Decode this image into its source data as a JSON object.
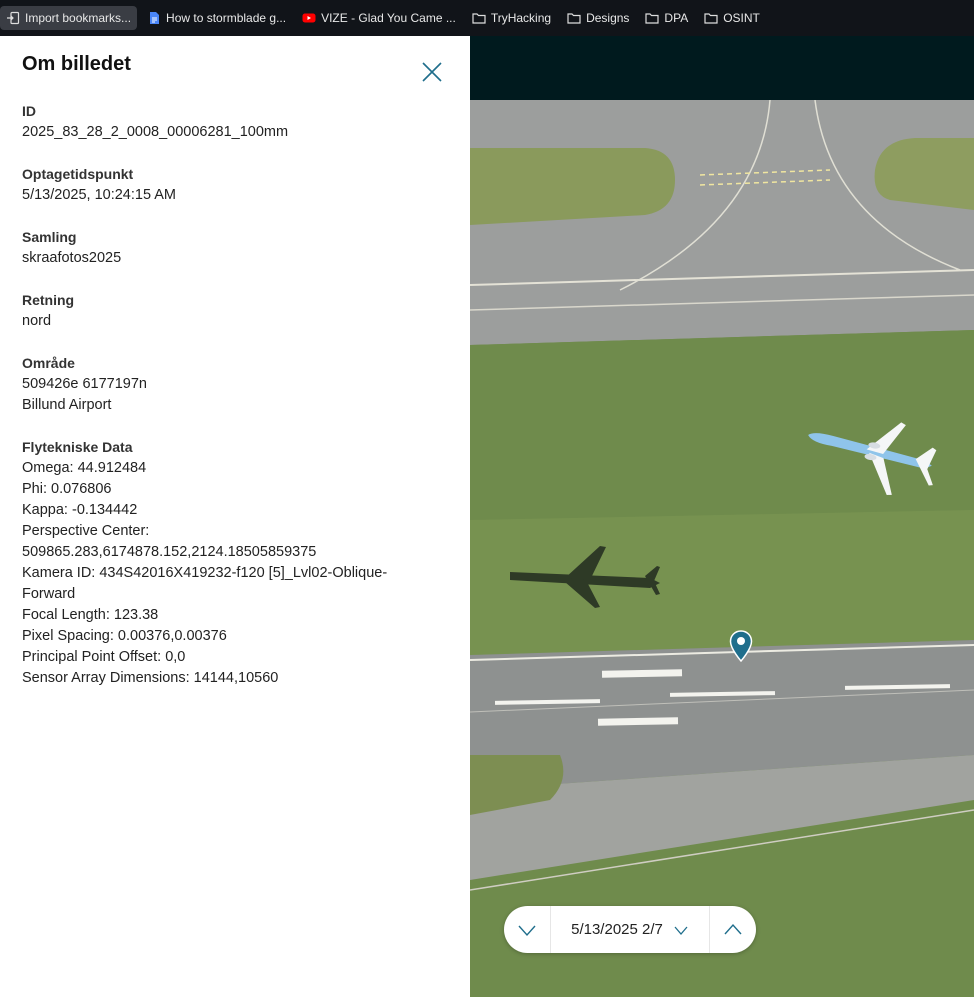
{
  "bookmarks": [
    {
      "label": "Import bookmarks...",
      "icon": "import-icon",
      "active": true
    },
    {
      "label": "How to stormblade g...",
      "icon": "google-docs-icon"
    },
    {
      "label": "VIZE - Glad You Came ...",
      "icon": "youtube-icon"
    },
    {
      "label": "TryHacking",
      "icon": "folder-icon"
    },
    {
      "label": "Designs",
      "icon": "folder-icon"
    },
    {
      "label": "DPA",
      "icon": "folder-icon"
    },
    {
      "label": "OSINT",
      "icon": "folder-icon"
    }
  ],
  "panel": {
    "title": "Om billedet",
    "fields": {
      "id": {
        "label": "ID",
        "value": "2025_83_28_2_0008_00006281_100mm"
      },
      "time": {
        "label": "Optagetidspunkt",
        "value": "5/13/2025, 10:24:15 AM"
      },
      "collection": {
        "label": "Samling",
        "value": "skraafotos2025"
      },
      "direction": {
        "label": "Retning",
        "value": "nord"
      },
      "area": {
        "label": "Område",
        "coords": "509426e 6177197n",
        "place": "Billund Airport"
      },
      "flight": {
        "label": "Flytekniske Data",
        "lines": [
          "Omega: 44.912484",
          "Phi: 0.076806",
          "Kappa: -0.134442",
          "Perspective Center:",
          "509865.283,6174878.152,2124.18505859375",
          "Kamera ID: 434S42016X419232-f120 [5]_Lvl02-Oblique-",
          "Forward",
          "Focal Length: 123.38",
          "Pixel Spacing: 0.00376,0.00376",
          "Principal Point Offset: 0,0",
          "Sensor Array Dimensions: 14144,10560"
        ]
      }
    }
  },
  "nav": {
    "label": "5/13/2025 2/7"
  },
  "colors": {
    "accent": "#1f6e8c",
    "grass": "#6f8b4c",
    "tarmac": "#9a9c9b",
    "header": "#001a1e"
  }
}
